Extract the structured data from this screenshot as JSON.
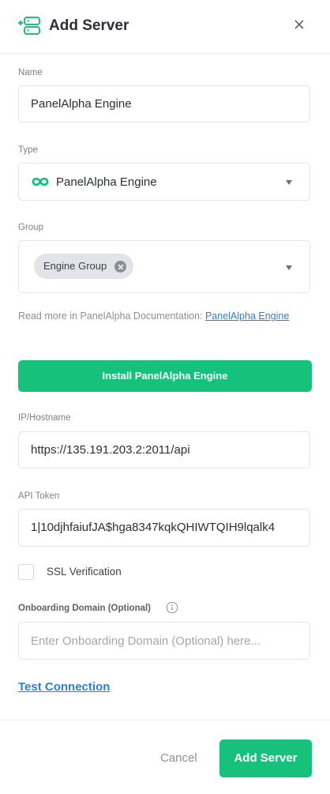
{
  "header": {
    "title": "Add Server",
    "icon": "add-server-icon",
    "close_icon": "close-icon"
  },
  "name": {
    "label": "Name",
    "value": "PanelAlpha Engine"
  },
  "type": {
    "label": "Type",
    "value": "PanelAlpha Engine",
    "icon": "panelalpha-logo-icon"
  },
  "group": {
    "label": "Group",
    "chips": [
      "Engine Group"
    ]
  },
  "docs": {
    "text": "Read more in PanelAlpha Documentation: ",
    "link": "PanelAlpha Engine"
  },
  "install": {
    "label": "Install PanelAlpha Engine"
  },
  "hostname": {
    "label": "IP/Hostname",
    "value": "https://135.191.203.2:2011/api"
  },
  "api_token": {
    "label": "API Token",
    "value": "1|10djhfaiufJA$hga8347kqkQHIWTQIH9lqalk4"
  },
  "ssl": {
    "label": "SSL Verification",
    "checked": false
  },
  "onboarding": {
    "label": "Onboarding Domain (Optional)",
    "placeholder": "Enter Onboarding Domain (Optional) here..."
  },
  "test_connection": {
    "label": "Test Connection"
  },
  "footer": {
    "cancel_label": "Cancel",
    "submit_label": "Add Server"
  },
  "colors": {
    "accent": "#16c17c",
    "link": "#2d7fd3"
  }
}
